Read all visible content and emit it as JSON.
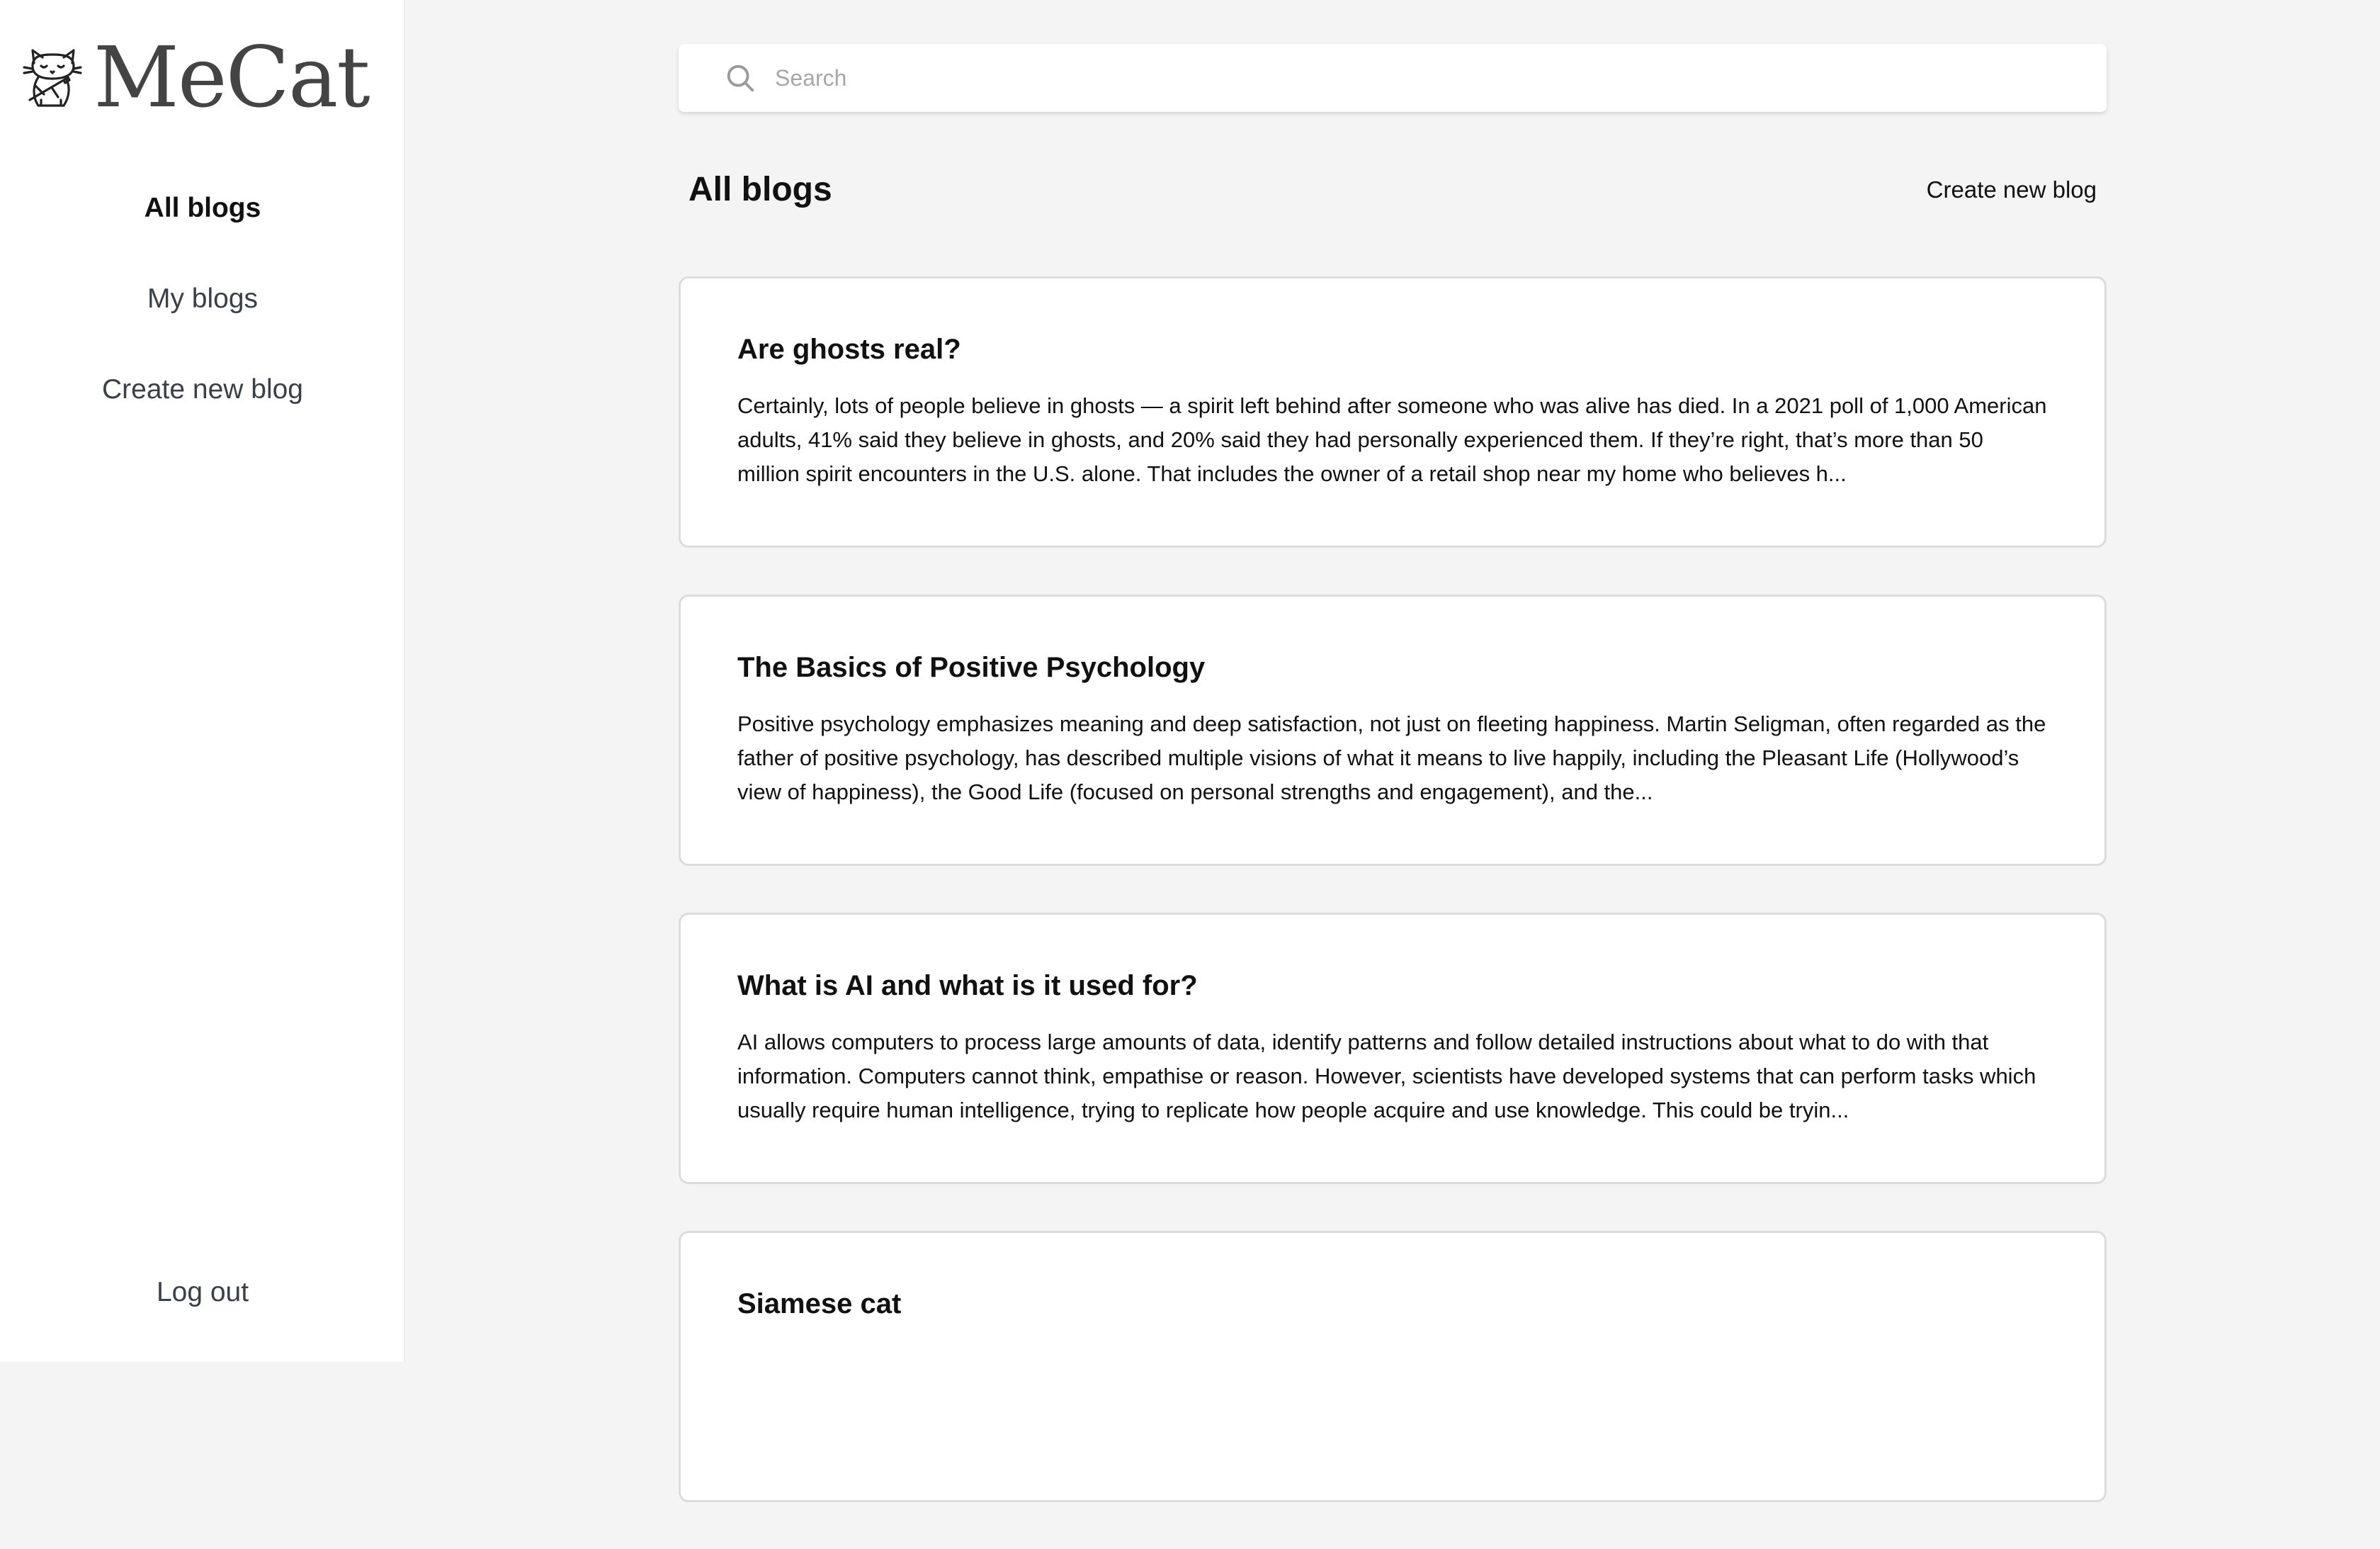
{
  "app": {
    "name": "MeCat",
    "logo_icon": "cat-writing-icon"
  },
  "sidebar": {
    "items": [
      {
        "label": "All blogs",
        "active": true
      },
      {
        "label": "My blogs",
        "active": false
      },
      {
        "label": "Create new blog",
        "active": false
      }
    ],
    "logout_label": "Log out"
  },
  "search": {
    "placeholder": "Search",
    "value": "",
    "icon": "search-icon"
  },
  "main": {
    "title": "All blogs",
    "create_label": "Create new blog",
    "blogs": [
      {
        "title": "Are ghosts real?",
        "excerpt": "Certainly, lots of people believe in ghosts — a spirit left behind after someone who was alive has died. In a 2021 poll of 1,000 American adults, 41% said they believe in ghosts, and 20% said they had personally experienced them. If they’re right, that’s more than 50 million spirit encounters in the U.S. alone. That includes the owner of a retail shop near my home who believes h..."
      },
      {
        "title": "The Basics of Positive Psychology",
        "excerpt": "Positive psychology emphasizes meaning and deep satisfaction, not just on fleeting happiness. Martin Seligman, often regarded as the father of positive psychology, has described multiple visions of what it means to live happily, including the Pleasant Life (Hollywood’s view of happiness), the Good Life (focused on personal strengths and engagement), and the..."
      },
      {
        "title": "What is AI and what is it used for?",
        "excerpt": "AI allows computers to process large amounts of data, identify patterns and follow detailed instructions about what to do with that information. Computers cannot think, empathise or reason. However, scientists have developed systems that can perform tasks which usually require human intelligence, trying to replicate how people acquire and use knowledge. This could be tryin..."
      },
      {
        "title": "Siamese cat",
        "excerpt": ""
      }
    ]
  },
  "colors": {
    "page_background": "#f4f4f4",
    "sidebar_background": "#ffffff",
    "card_border": "#dcdcdc",
    "nav_text": "#3b3f46",
    "placeholder": "#a7a7a7"
  }
}
